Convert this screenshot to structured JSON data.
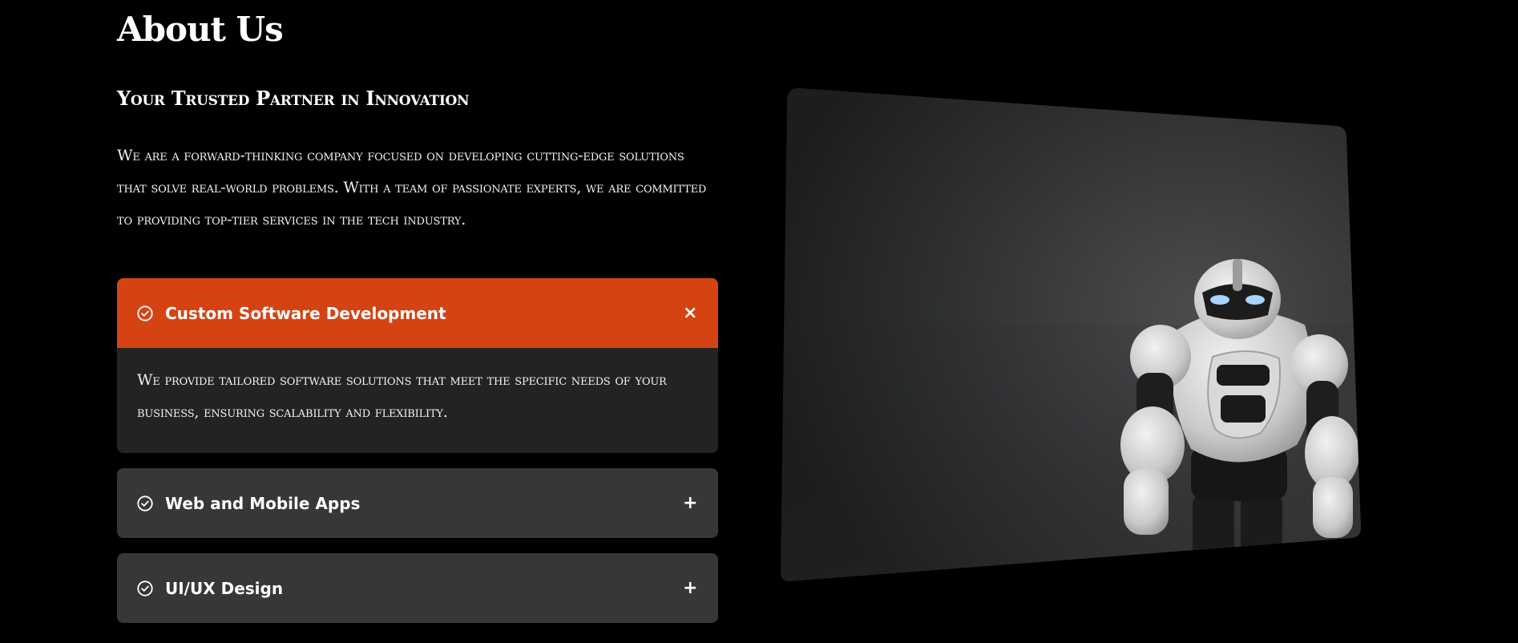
{
  "about": {
    "title": "About Us",
    "subtitle": "Your Trusted Partner in Innovation",
    "intro": "We are a forward-thinking company focused on developing cutting-edge solutions that solve real-world problems. With a team of passionate experts, we are committed to providing top-tier services in the tech industry."
  },
  "accordion": {
    "items": [
      {
        "title": "Custom Software Development",
        "icon": "check-circle-icon",
        "toggle": "×",
        "expanded": true,
        "body": "We provide tailored software solutions that meet the specific needs of your business, ensuring scalability and flexibility."
      },
      {
        "title": "Web and Mobile Apps",
        "icon": "check-circle-icon",
        "toggle": "+",
        "expanded": false
      },
      {
        "title": "UI/UX Design",
        "icon": "check-circle-icon",
        "toggle": "+",
        "expanded": false
      }
    ]
  },
  "image": {
    "subject": "robot"
  },
  "colors": {
    "background": "#000000",
    "accent": "#d54313",
    "card": "#373737",
    "card_body": "#232323",
    "text": "#ffffff"
  }
}
